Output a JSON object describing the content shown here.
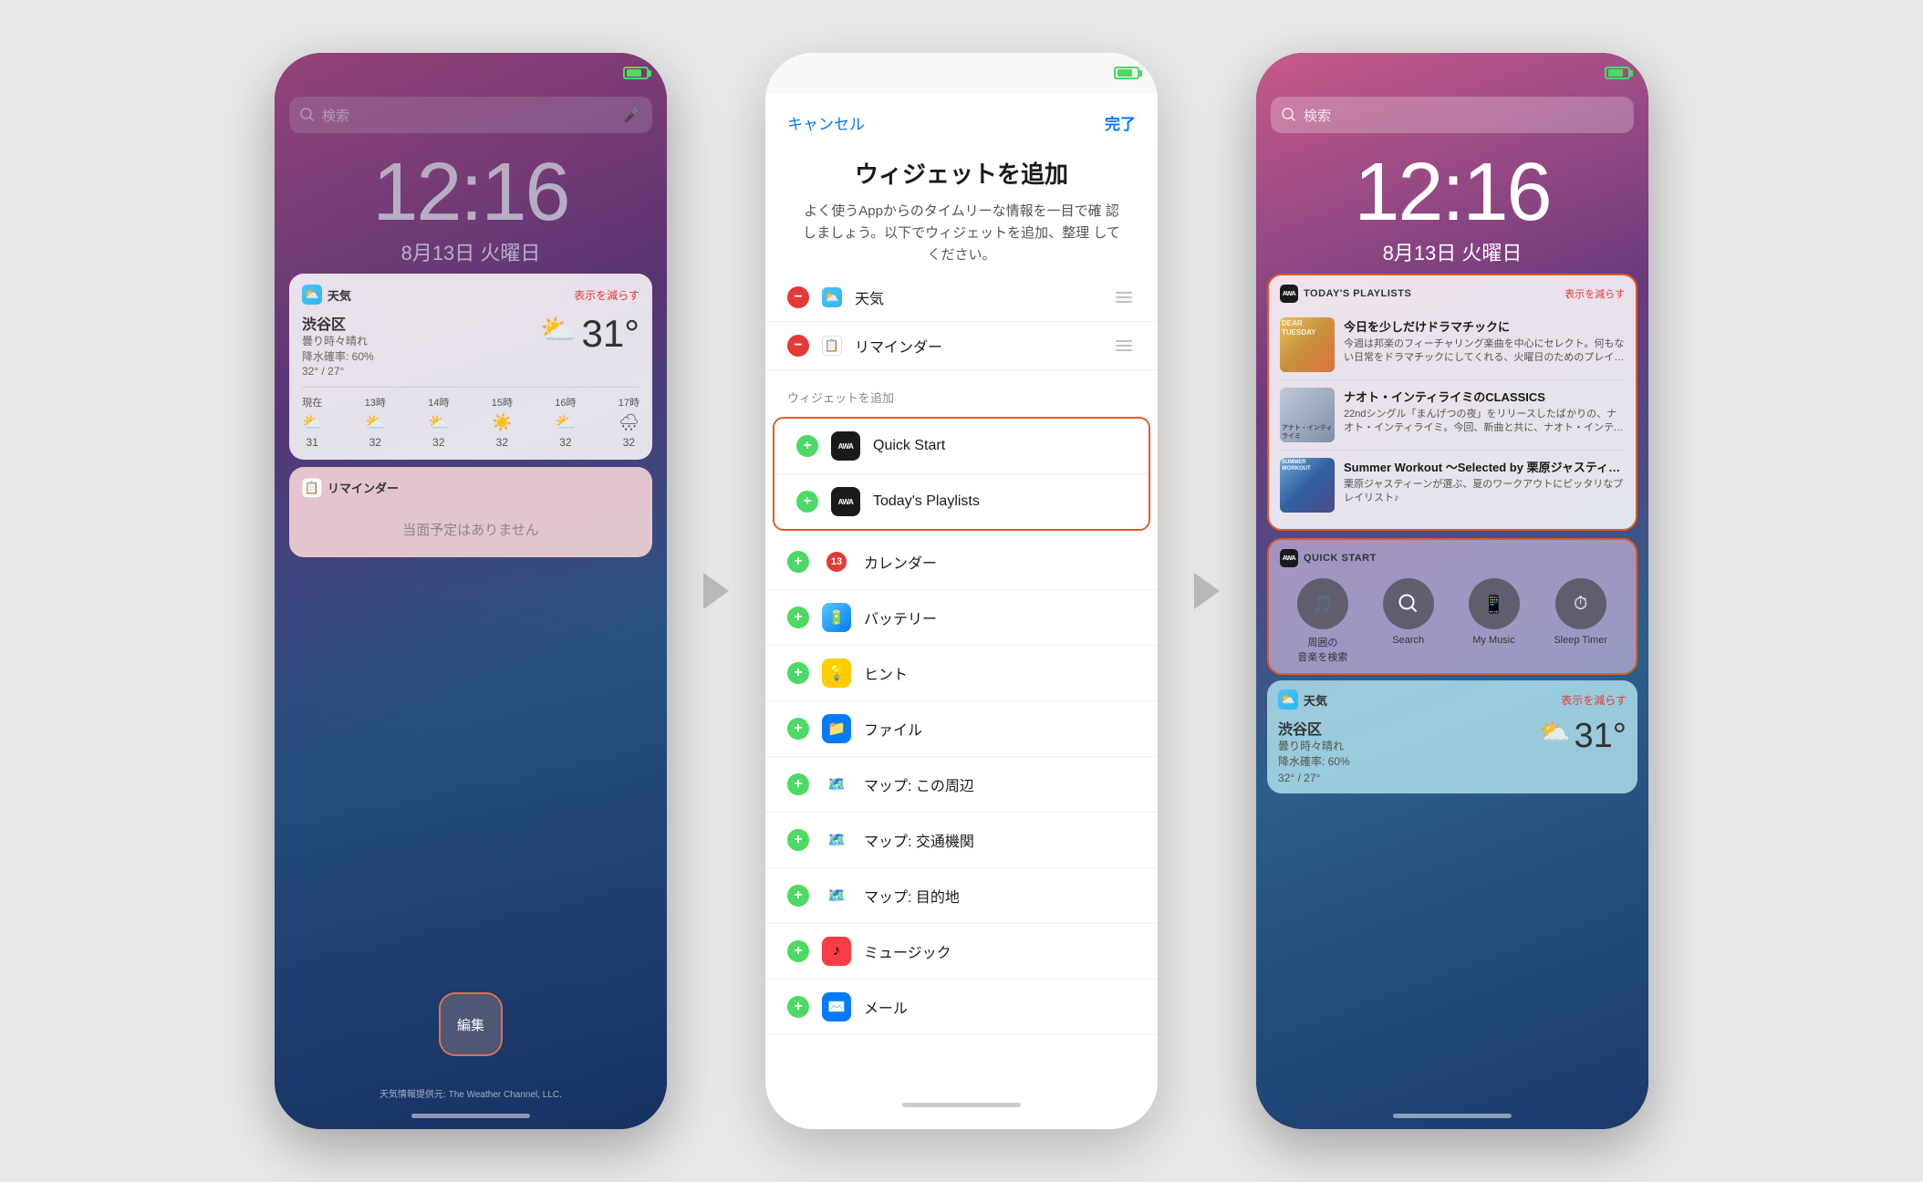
{
  "screen1": {
    "statusBar": {
      "battery": "green"
    },
    "searchBar": {
      "placeholder": "検索",
      "micIcon": "🎤"
    },
    "clock": {
      "time": "12:16",
      "date": "8月13日 火曜日"
    },
    "weatherWidget": {
      "title": "天気",
      "collapseLabel": "表示を減らす",
      "location": "渋谷区",
      "condition": "曇り時々晴れ\n降水確率: 60%",
      "tempHigh": "32°",
      "tempLow": "27°",
      "currentTemp": "31°",
      "hours": [
        {
          "label": "現在",
          "icon": "⛅",
          "temp": "31"
        },
        {
          "label": "13時",
          "icon": "⛅",
          "temp": "32"
        },
        {
          "label": "14時",
          "icon": "⛅",
          "temp": "32"
        },
        {
          "label": "15時",
          "icon": "☀️",
          "temp": "32"
        },
        {
          "label": "16時",
          "icon": "⛅",
          "temp": "32"
        },
        {
          "label": "17時",
          "icon": "🌧",
          "temp": "32"
        }
      ]
    },
    "reminderWidget": {
      "title": "リマインダー",
      "emptyText": "当面予定はありません"
    },
    "editButton": "編集",
    "attribution": "天気情報提供元: The Weather Channel, LLC."
  },
  "middle": {
    "cancelLabel": "キャンセル",
    "doneLabel": "完了",
    "title": "ウィジェットを追加",
    "description": "よく使うAppからのタイムリーな情報を一目で確\n認しましょう。以下でウィジェットを追加、整理\nしてください。",
    "activeWidgets": [
      {
        "id": "weather",
        "name": "天気",
        "type": "minus"
      },
      {
        "id": "reminder",
        "name": "リマインダー",
        "type": "minus"
      }
    ],
    "sectionLabel": "ウィジェットを追加",
    "availableWidgets": [
      {
        "id": "quick-start",
        "name": "Quick Start",
        "appIcon": "AWA",
        "highlight": true
      },
      {
        "id": "todays-playlists",
        "name": "Today's Playlists",
        "appIcon": "AWA",
        "highlight": true
      },
      {
        "id": "calendar",
        "name": "カレンダー",
        "badge": "13"
      },
      {
        "id": "battery",
        "name": "バッテリー",
        "iconType": "battery"
      },
      {
        "id": "hint",
        "name": "ヒント",
        "iconType": "hint"
      },
      {
        "id": "files",
        "name": "ファイル",
        "iconType": "files"
      },
      {
        "id": "maps-nearby",
        "name": "マップ: この周辺",
        "iconType": "maps"
      },
      {
        "id": "maps-transit",
        "name": "マップ: 交通機関",
        "iconType": "maps"
      },
      {
        "id": "maps-destination",
        "name": "マップ: 目的地",
        "iconType": "maps"
      },
      {
        "id": "music",
        "name": "ミュージック",
        "iconType": "music"
      },
      {
        "id": "mail",
        "name": "メール",
        "iconType": "mail"
      }
    ]
  },
  "screen3": {
    "statusBar": {
      "battery": "green"
    },
    "searchBar": {
      "placeholder": "検索"
    },
    "clock": {
      "time": "12:16",
      "date": "8月13日 火曜日"
    },
    "todaysPlaylistsWidget": {
      "title": "TODAY'S PLAYLISTS",
      "collapseLabel": "表示を減らす",
      "playlists": [
        {
          "id": "dear-tuesday",
          "title": "今日を少しだけドラマチックに",
          "desc": "今週は邦楽のフィーチャリング楽曲を中心にセレクト。何もない日常をドラマチックにしてくれる、火曜日のためのプレイリスト「Dear...",
          "thumbClass": "dear-tuesday"
        },
        {
          "id": "naoto",
          "title": "ナオト・インティライミのCLASSICS",
          "desc": "22ndシングル「まんげつの夜」をリリースしたばかりの、ナオト・インティライミ。今回、新曲と共に、ナオト・インティライミの代表曲...",
          "thumbClass": "naoto"
        },
        {
          "id": "summer",
          "title": "Summer Workout 〜Selected by 栗原ジャスティーン〜",
          "desc": "栗原ジャスティーンが選ぶ、夏のワークアウトにピッタリなプレイリスト♪",
          "thumbClass": "summer"
        }
      ]
    },
    "quickStartWidget": {
      "title": "QUICK START",
      "buttons": [
        {
          "id": "nearby-music",
          "label": "周囲の\n音楽を検索",
          "icon": "🎵"
        },
        {
          "id": "search",
          "label": "Search"
        },
        {
          "id": "my-music",
          "label": "My Music"
        },
        {
          "id": "sleep-timer",
          "label": "Sleep Timer"
        }
      ]
    },
    "weatherWidget": {
      "title": "天気",
      "collapseLabel": "表示を減らす",
      "location": "渋谷区",
      "condition": "曇り時々晴れ\n降水確率: 60%",
      "currentTemp": "31°",
      "tempRange": "32° / 27°"
    }
  }
}
